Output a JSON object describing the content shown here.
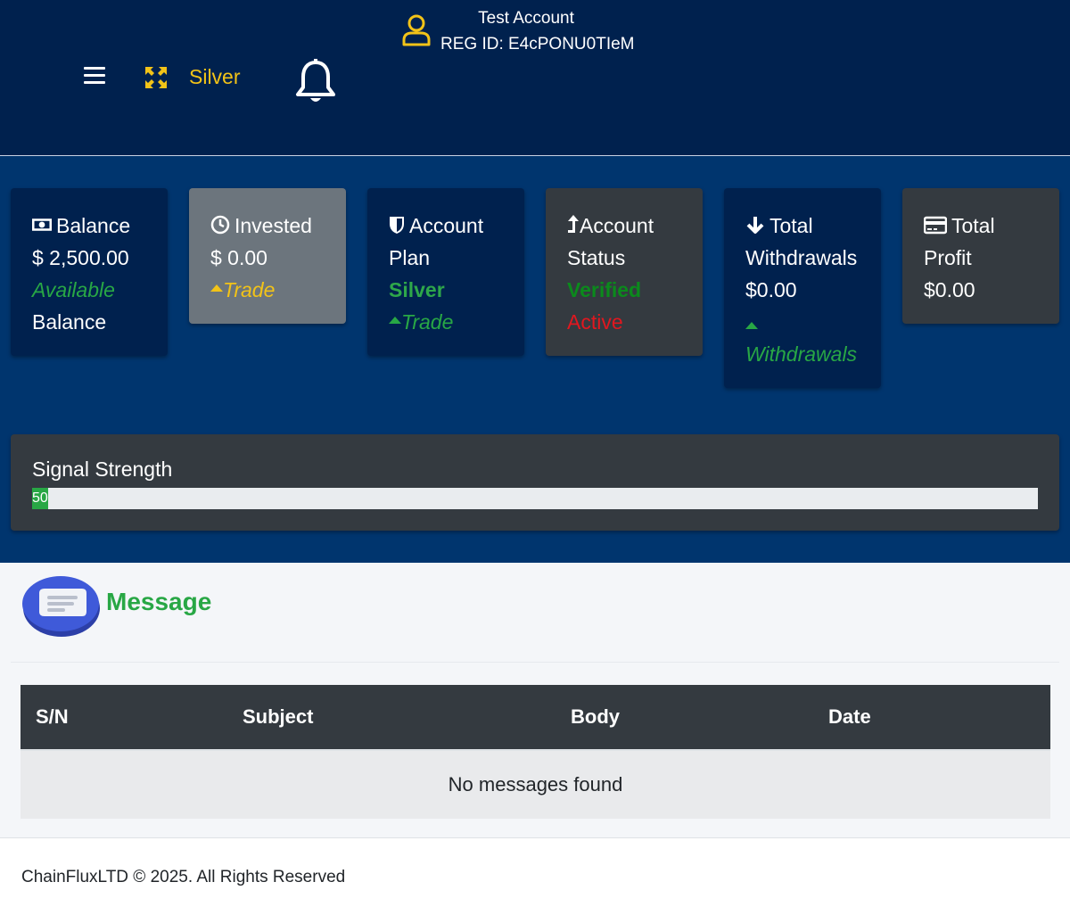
{
  "header": {
    "plan_label": "Silver",
    "account_name": "Test Account",
    "reg_id": "REG ID: E4cPONU0TIeM"
  },
  "cards": {
    "balance": {
      "title": "Balance",
      "value": "$ 2,500.00",
      "sub": "Available",
      "sub2": "Balance"
    },
    "invested": {
      "title": "Invested",
      "value": "$ 0.00",
      "sub": "Trade"
    },
    "plan": {
      "title1": "Account",
      "title2": "Plan",
      "value": "Silver",
      "sub": "Trade"
    },
    "status": {
      "title1": "Account",
      "title2": "Status",
      "verified": "Verified",
      "active": "Active"
    },
    "withdrawals": {
      "title1": "Total",
      "title2": "Withdrawals",
      "value": "$0.00",
      "sub": "Withdrawals"
    },
    "profit": {
      "title1": "Total",
      "title2": "Profit",
      "value": "$0.00"
    }
  },
  "signal": {
    "title": "Signal Strength",
    "label": "50",
    "fraction": 0.016
  },
  "messages": {
    "title": "Message",
    "columns": [
      "S/N",
      "Subject",
      "Body",
      "Date"
    ],
    "empty": "No messages found"
  },
  "footer": {
    "text": "ChainFluxLTD © 2025. All Rights Reserved"
  },
  "colors": {
    "navy": "#00214e",
    "blue": "#00356e",
    "yellow": "#f2c318",
    "green": "#28a745",
    "red": "#e1171f",
    "dark": "#343a40"
  }
}
